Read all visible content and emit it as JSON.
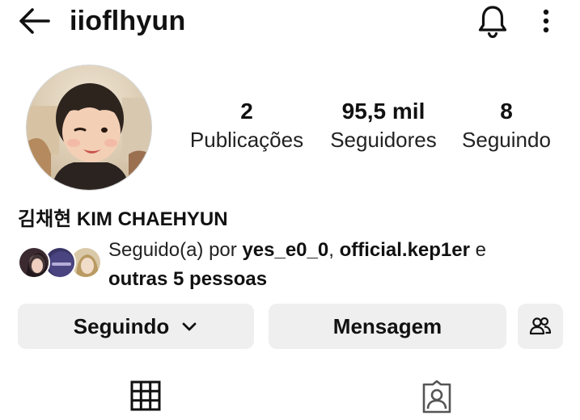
{
  "header": {
    "username": "iioflhyun",
    "back_icon": "arrow-left-icon",
    "notifications_icon": "bell-icon",
    "more_icon": "more-vertical-icon"
  },
  "profile": {
    "avatar": "profile-photo",
    "stats": [
      {
        "value": "2",
        "label": "Publicações"
      },
      {
        "value": "95,5 mil",
        "label": "Seguidores"
      },
      {
        "value": "8",
        "label": "Seguindo"
      }
    ],
    "display_name": "김채현 KIM CHAEHYUN",
    "followed_by": {
      "prefix": "Seguido(a) por ",
      "user1": "yes_e0_0",
      "separator": ", ",
      "user2": "official.kep1er",
      "conjunction": " e",
      "others": "outras 5 pessoas"
    }
  },
  "actions": {
    "following_label": "Seguindo",
    "message_label": "Mensagem",
    "suggest_icon": "add-people-icon"
  },
  "tabs": {
    "grid_icon": "grid-icon",
    "tagged_icon": "tagged-person-icon"
  },
  "colors": {
    "button_bg": "#efefef",
    "text": "#111111"
  }
}
